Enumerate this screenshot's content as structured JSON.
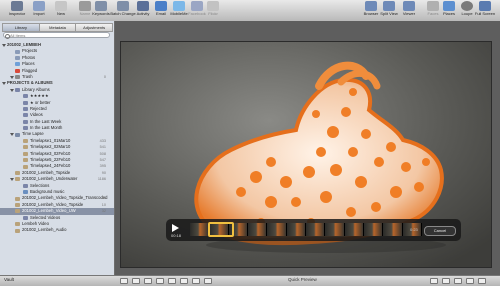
{
  "toolbar": {
    "left": [
      "Inspector",
      "Import",
      "New",
      "Name",
      "Keywords",
      "Batch Change",
      "Activity",
      "Email",
      "MobileMe",
      "Facebook",
      "Flickr"
    ],
    "right": [
      "Browser",
      "Split View",
      "Viewer",
      "Faces",
      "Places",
      "Loupe",
      "Full Screen"
    ]
  },
  "sidebar": {
    "tabs": [
      "Library",
      "Metadata",
      "Adjustments"
    ],
    "search_placeholder": "All Items",
    "rows": [
      {
        "label": "201002_LEMBEH",
        "level": 0,
        "icon": "header",
        "count": ""
      },
      {
        "label": "Projects",
        "level": 1,
        "icon": "projects-icon",
        "count": ""
      },
      {
        "label": "Photos",
        "level": 1,
        "icon": "photos-icon",
        "count": ""
      },
      {
        "label": "Places",
        "level": 1,
        "icon": "places-icon",
        "count": ""
      },
      {
        "label": "Flagged",
        "level": 1,
        "icon": "flag-icon",
        "count": ""
      },
      {
        "label": "Trash",
        "level": 1,
        "icon": "trash-icon",
        "count": "0"
      },
      {
        "label": "PROJECTS & ALBUMS",
        "level": 0,
        "icon": "header",
        "count": ""
      },
      {
        "label": "Library Albums",
        "level": 1,
        "icon": "album-icon",
        "count": ""
      },
      {
        "label": "★★★★★",
        "level": 2,
        "icon": "album-icon",
        "count": ""
      },
      {
        "label": "★ or better",
        "level": 2,
        "icon": "album-icon",
        "count": ""
      },
      {
        "label": "Rejected",
        "level": 2,
        "icon": "album-icon",
        "count": ""
      },
      {
        "label": "Videos",
        "level": 2,
        "icon": "album-icon",
        "count": ""
      },
      {
        "label": "In the Last Week",
        "level": 2,
        "icon": "album-icon",
        "count": ""
      },
      {
        "label": "In the Last Month",
        "level": 2,
        "icon": "album-icon",
        "count": ""
      },
      {
        "label": "Time Lapse",
        "level": 1,
        "icon": "folder-icon",
        "count": ""
      },
      {
        "label": "Timelapse1_01Mar10",
        "level": 2,
        "icon": "project-icon",
        "count": "433"
      },
      {
        "label": "Timelapse2_02Mar10",
        "level": 2,
        "icon": "project-icon",
        "count": "541"
      },
      {
        "label": "Timelapse3_02Feb10",
        "level": 2,
        "icon": "project-icon",
        "count": "508"
      },
      {
        "label": "Timelapse5_22Feb10",
        "level": 2,
        "icon": "project-icon",
        "count": "547"
      },
      {
        "label": "Timelapse4_24Feb10",
        "level": 2,
        "icon": "project-icon",
        "count": "395"
      },
      {
        "label": "201002_Lembeh_Topside",
        "level": 1,
        "icon": "project-icon",
        "count": "90"
      },
      {
        "label": "201002_Lembeh_Underwater",
        "level": 1,
        "icon": "project-icon",
        "count": "1186"
      },
      {
        "label": "Selections",
        "level": 2,
        "icon": "album-icon",
        "count": ""
      },
      {
        "label": "Background music",
        "level": 2,
        "icon": "music-icon",
        "count": ""
      },
      {
        "label": "201002_Lembeh_Video_Topside_Transcoded",
        "level": 1,
        "icon": "project-icon",
        "count": "20"
      },
      {
        "label": "201002_Lembeh_Video_Topside",
        "level": 1,
        "icon": "project-icon",
        "count": "10"
      },
      {
        "label": "201002_Lembeh_Video_UW",
        "level": 1,
        "icon": "project-icon",
        "count": "32",
        "selected": true
      },
      {
        "label": "Selected Videos",
        "level": 2,
        "icon": "album-icon",
        "count": ""
      },
      {
        "label": "Lembeh Video",
        "level": 1,
        "icon": "project-icon",
        "count": ""
      },
      {
        "label": "201002_Lembeh_Audio",
        "level": 1,
        "icon": "project-icon",
        "count": ""
      }
    ]
  },
  "viewer": {
    "timecode": "00:18",
    "remaining": "0:23",
    "cancel_label": "Cancel"
  },
  "bottombar": {
    "left_label": "Vault",
    "center_label": "Quick Preview"
  }
}
